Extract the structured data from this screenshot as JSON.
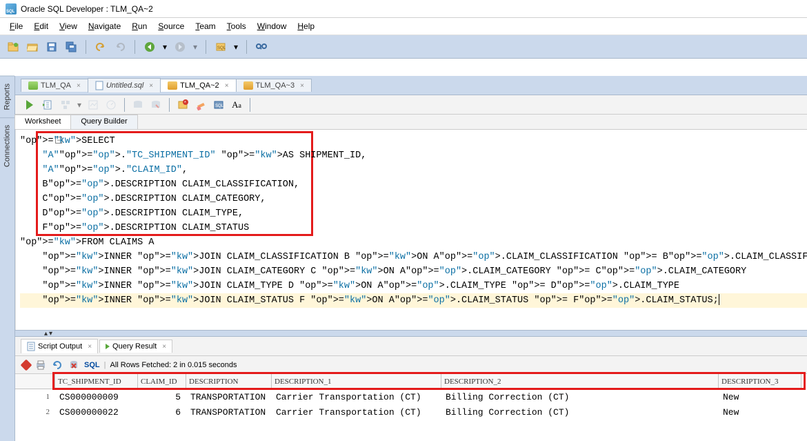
{
  "window_title": "Oracle SQL Developer : TLM_QA~2",
  "menubar": [
    "File",
    "Edit",
    "View",
    "Navigate",
    "Run",
    "Source",
    "Team",
    "Tools",
    "Window",
    "Help"
  ],
  "menu_uline": [
    "F",
    "E",
    "V",
    "N",
    "R",
    "S",
    "T",
    "T",
    "W",
    "H"
  ],
  "side_tabs": [
    "Reports",
    "Connections"
  ],
  "editor_tabs": [
    {
      "label": "TLM_QA",
      "active": false,
      "icon": "green"
    },
    {
      "label": "Untitled.sql",
      "active": false,
      "italic": true,
      "icon": "paper"
    },
    {
      "label": "TLM_QA~2",
      "active": true,
      "icon": "sql"
    },
    {
      "label": "TLM_QA~3",
      "active": false,
      "icon": "sql"
    }
  ],
  "sub_tabs": [
    "Worksheet",
    "Query Builder"
  ],
  "sql_lines": [
    {
      "t": "SELECT",
      "cls": "kw",
      "indent": 0,
      "fold": true
    },
    {
      "t": "\"A\".\"TC_SHIPMENT_ID\" AS SHIPMENT_ID,",
      "indent": 1,
      "kw": [
        "AS"
      ]
    },
    {
      "t": "\"A\".\"CLAIM_ID\",",
      "indent": 1
    },
    {
      "t": "B.DESCRIPTION CLAIM_CLASSIFICATION,",
      "indent": 1,
      "op": "."
    },
    {
      "t": "C.DESCRIPTION CLAIM_CATEGORY,",
      "indent": 1,
      "op": "."
    },
    {
      "t": "D.DESCRIPTION CLAIM_TYPE,",
      "indent": 1,
      "op": "."
    },
    {
      "t": "F.DESCRIPTION CLAIM_STATUS",
      "indent": 1,
      "op": "."
    },
    {
      "t": "FROM CLAIMS A",
      "indent": 0,
      "kw": [
        "FROM"
      ]
    },
    {
      "t": "INNER JOIN CLAIM_CLASSIFICATION B ON A.CLAIM_CLASSIFICATION = B.CLAIM_CLASSIFICATION",
      "indent": 1,
      "kw": [
        "INNER",
        "JOIN",
        "ON"
      ],
      "op": "."
    },
    {
      "t": "INNER JOIN CLAIM_CATEGORY C ON A.CLAIM_CATEGORY = C.CLAIM_CATEGORY",
      "indent": 1,
      "kw": [
        "INNER",
        "JOIN",
        "ON"
      ],
      "op": "."
    },
    {
      "t": "INNER JOIN CLAIM_TYPE D ON A.CLAIM_TYPE = D.CLAIM_TYPE",
      "indent": 1,
      "kw": [
        "INNER",
        "JOIN",
        "ON"
      ],
      "op": "."
    },
    {
      "t": "INNER JOIN CLAIM_STATUS F ON A.CLAIM_STATUS = F.CLAIM_STATUS;",
      "indent": 1,
      "kw": [
        "INNER",
        "JOIN",
        "ON"
      ],
      "op": ".",
      "hl": true,
      "caret": true
    }
  ],
  "output_tabs": [
    {
      "label": "Script Output",
      "closable": true,
      "icon": "paper"
    },
    {
      "label": "Query Result",
      "closable": true,
      "icon": "run"
    }
  ],
  "fetch_status": "All Rows Fetched: 2 in 0.015 seconds",
  "sql_link": "SQL",
  "grid_headers": [
    "TC_SHIPMENT_ID",
    "CLAIM_ID",
    "DESCRIPTION",
    "DESCRIPTION_1",
    "DESCRIPTION_2",
    "DESCRIPTION_3"
  ],
  "grid_rows": [
    {
      "n": "1",
      "c": [
        "CS000000009",
        "5",
        "TRANSPORTATION",
        "Carrier Transportation (CT)",
        "Billing Correction (CT)",
        "New"
      ]
    },
    {
      "n": "2",
      "c": [
        "CS000000022",
        "6",
        "TRANSPORTATION",
        "Carrier Transportation (CT)",
        "Billing Correction (CT)",
        "New"
      ]
    }
  ]
}
